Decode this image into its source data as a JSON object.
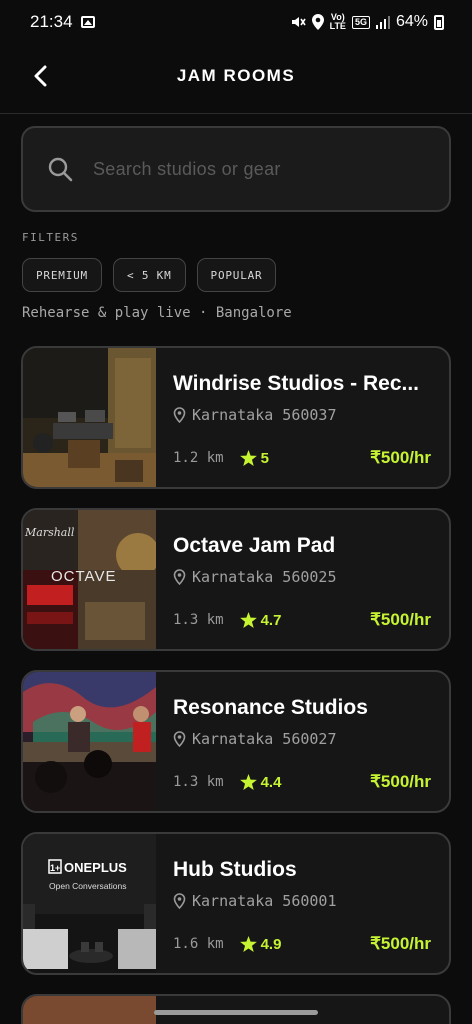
{
  "status_bar": {
    "time": "21:34",
    "battery": "64%",
    "net_top": "Vo)",
    "net_bottom": "LTE",
    "net_5g": "5G"
  },
  "header": {
    "title": "JAM ROOMS",
    "back_icon": "chevron-left-icon"
  },
  "search": {
    "placeholder": "Search studios or gear",
    "icon": "search-icon"
  },
  "filters": {
    "label": "FILTERS",
    "chips": [
      "PREMIUM",
      "< 5 KM",
      "POPULAR"
    ]
  },
  "subtitle": "Rehearse & play live · Bangalore",
  "colors": {
    "accent": "#c6f432",
    "card_bg": "#161616",
    "border": "#3a3a3a"
  },
  "studios": [
    {
      "name": "Windrise Studios - Rec...",
      "location": "Karnataka 560037",
      "distance": "1.2 km",
      "rating": "5",
      "price": "₹500/hr"
    },
    {
      "name": "Octave Jam Pad",
      "location": "Karnataka 560025",
      "distance": "1.3 km",
      "rating": "4.7",
      "price": "₹500/hr",
      "image_text": "OCTAVE",
      "image_brand": "Marshall"
    },
    {
      "name": "Resonance Studios",
      "location": "Karnataka 560027",
      "distance": "1.3 km",
      "rating": "4.4",
      "price": "₹500/hr"
    },
    {
      "name": "Hub Studios",
      "location": "Karnataka 560001",
      "distance": "1.6 km",
      "rating": "4.9",
      "price": "₹500/hr",
      "image_text": "ONEPLUS",
      "image_subtext": "Open Conversations",
      "image_logo": "1+"
    }
  ]
}
